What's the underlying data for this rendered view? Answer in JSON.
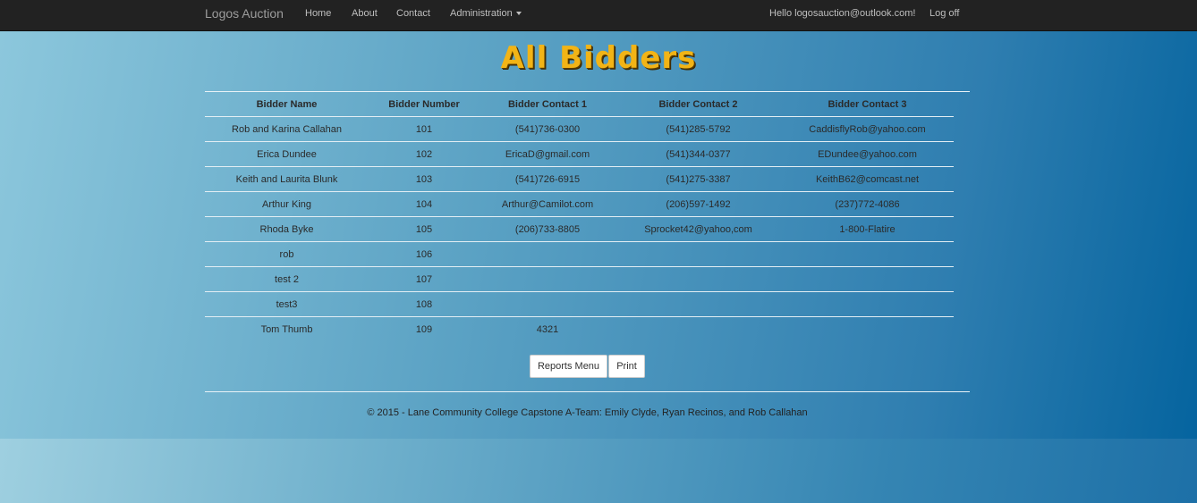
{
  "nav": {
    "brand": "Logos Auction",
    "links": [
      "Home",
      "About",
      "Contact"
    ],
    "admin": "Administration",
    "greeting": "Hello logosauction@outlook.com!",
    "logoff": "Log off"
  },
  "page": {
    "title": "All Bidders"
  },
  "table": {
    "headers": [
      "Bidder Name",
      "Bidder Number",
      "Bidder Contact 1",
      "Bidder Contact 2",
      "Bidder Contact 3"
    ],
    "rows": [
      [
        "Rob and Karina Callahan",
        "101",
        "(541)736-0300",
        "(541)285-5792",
        "CaddisflyRob@yahoo.com"
      ],
      [
        "Erica Dundee",
        "102",
        "EricaD@gmail.com",
        "(541)344-0377",
        "EDundee@yahoo.com"
      ],
      [
        "Keith and Laurita Blunk",
        "103",
        "(541)726-6915",
        "(541)275-3387",
        "KeithB62@comcast.net"
      ],
      [
        "Arthur King",
        "104",
        "Arthur@Camilot.com",
        "(206)597-1492",
        "(237)772-4086"
      ],
      [
        "Rhoda Byke",
        "105",
        "(206)733-8805",
        "Sprocket42@yahoo,com",
        "1-800-Flatire"
      ],
      [
        "rob",
        "106",
        "",
        "",
        ""
      ],
      [
        "test 2",
        "107",
        "",
        "",
        ""
      ],
      [
        "test3",
        "108",
        "",
        "",
        ""
      ],
      [
        "Tom Thumb",
        "109",
        "4321",
        "",
        ""
      ]
    ]
  },
  "buttons": {
    "reports_menu": "Reports Menu",
    "print": "Print"
  },
  "footer": {
    "text": "© 2015 - Lane Community College Capstone A-Team: Emily Clyde, Ryan Recinos, and Rob Callahan"
  }
}
